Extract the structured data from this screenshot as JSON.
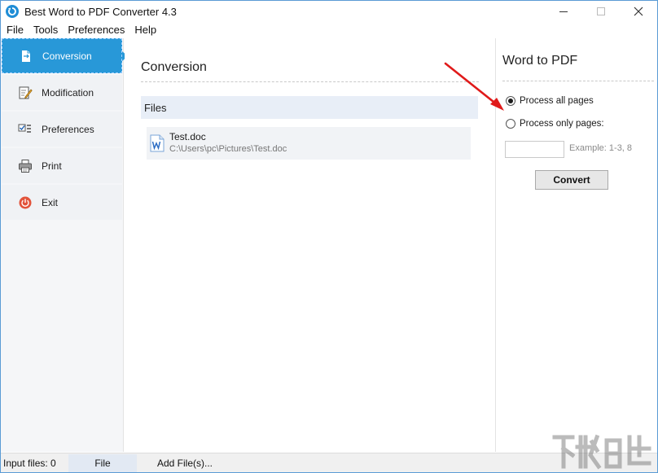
{
  "window": {
    "title": "Best Word to PDF Converter 4.3",
    "accent_color": "#2898d8"
  },
  "menu": [
    {
      "label": "File"
    },
    {
      "label": "Tools"
    },
    {
      "label": "Preferences"
    },
    {
      "label": "Help"
    }
  ],
  "sidebar": {
    "items": [
      {
        "label": "Conversion",
        "icon": "document-convert-icon",
        "active": true
      },
      {
        "label": "Modification",
        "icon": "edit-document-icon"
      },
      {
        "label": "Preferences",
        "icon": "checklist-icon"
      },
      {
        "label": "Print",
        "icon": "printer-icon"
      },
      {
        "label": "Exit",
        "icon": "power-icon"
      }
    ]
  },
  "center": {
    "title": "Conversion",
    "files_header": "Files",
    "files": [
      {
        "name": "Test.doc",
        "path": "C:\\Users\\pc\\Pictures\\Test.doc",
        "icon": "word-document-icon"
      }
    ]
  },
  "right": {
    "title": "Word to PDF",
    "options": [
      {
        "label": "Process all pages",
        "selected": true
      },
      {
        "label": "Process only pages:",
        "selected": false
      }
    ],
    "pages_input_value": "",
    "example_text": "Example: 1-3, 8",
    "convert_label": "Convert"
  },
  "status": {
    "input_files": "Input files: 0",
    "file_button": "File",
    "add_files_button": "Add File(s)..."
  }
}
